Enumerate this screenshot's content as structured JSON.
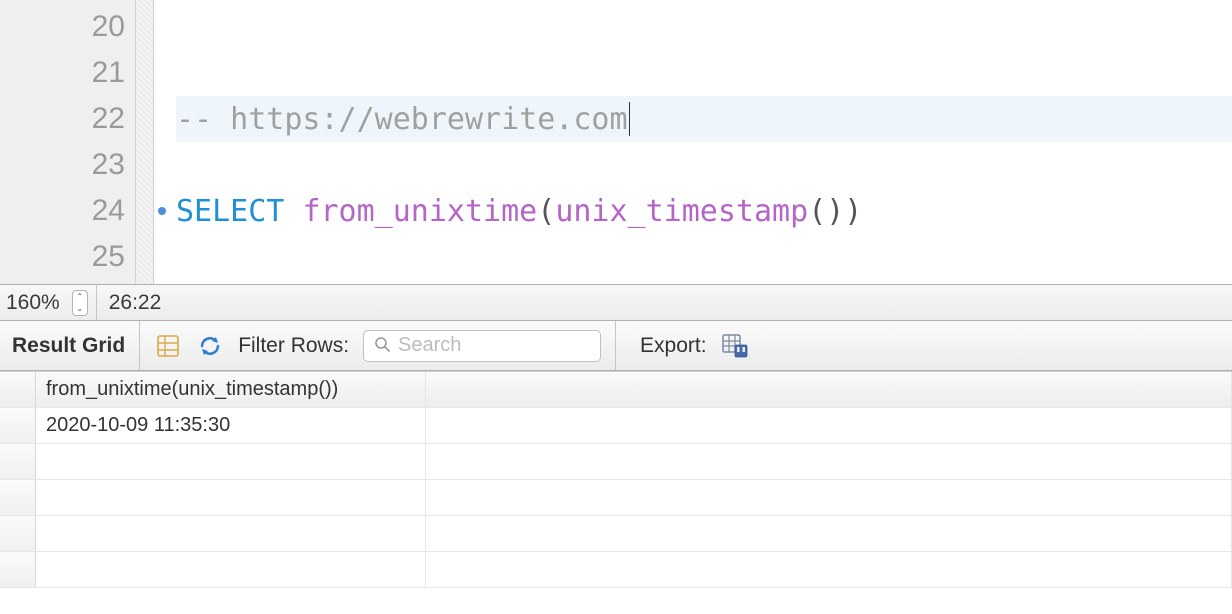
{
  "editor": {
    "lines": [
      {
        "num": "20",
        "segments": []
      },
      {
        "num": "21",
        "segments": []
      },
      {
        "num": "22",
        "current": true,
        "segments": [
          {
            "cls": "comment",
            "text": "-- https://webrewrite.com"
          },
          {
            "cls": "cursor",
            "text": ""
          }
        ]
      },
      {
        "num": "23",
        "segments": []
      },
      {
        "num": "24",
        "marker": true,
        "segments": [
          {
            "cls": "keyword",
            "text": "SELECT"
          },
          {
            "cls": "",
            "text": " "
          },
          {
            "cls": "func",
            "text": "from_unixtime"
          },
          {
            "cls": "punct",
            "text": "("
          },
          {
            "cls": "func",
            "text": "unix_timestamp"
          },
          {
            "cls": "punct",
            "text": "())"
          }
        ]
      },
      {
        "num": "25",
        "segments": []
      }
    ]
  },
  "statusbar": {
    "zoom": "160%",
    "position": "26:22"
  },
  "toolbar": {
    "result_label": "Result Grid",
    "filter_label": "Filter Rows:",
    "search_placeholder": "Search",
    "export_label": "Export:"
  },
  "result": {
    "columns": [
      "from_unixtime(unix_timestamp())"
    ],
    "rows": [
      [
        "2020-10-09 11:35:30"
      ]
    ],
    "blank_rows": 4
  }
}
